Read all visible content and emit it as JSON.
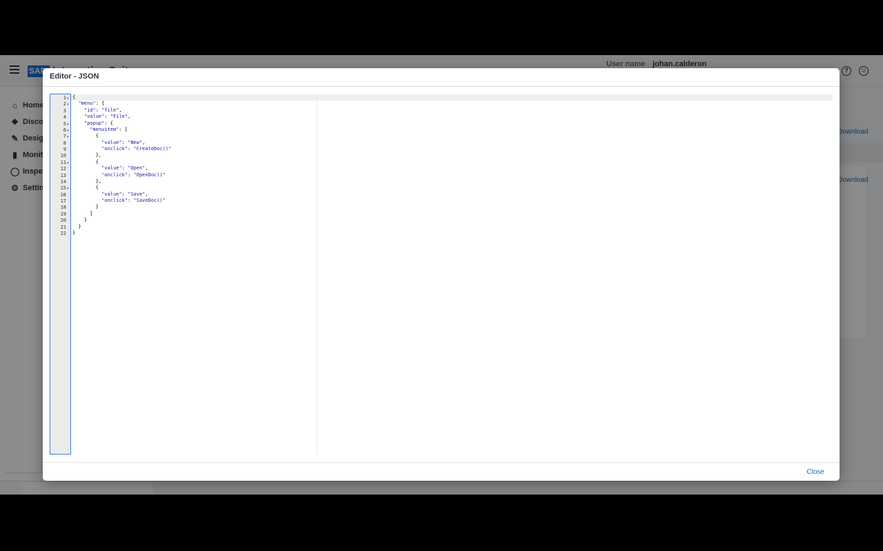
{
  "shell": {
    "logo_text": "SAP",
    "app_title": "Integration Suite",
    "user_label": "User name",
    "user_value": "johan.calderon"
  },
  "sidenav": {
    "items": [
      {
        "label": "Home",
        "icon": "home-icon"
      },
      {
        "label": "Discover",
        "icon": "compass-icon"
      },
      {
        "label": "Design",
        "icon": "pencil-icon"
      },
      {
        "label": "Monitor",
        "icon": "chart-bars-icon"
      },
      {
        "label": "Inspect",
        "icon": "gauge-icon"
      },
      {
        "label": "Settings",
        "icon": "gear-icon"
      }
    ]
  },
  "background": {
    "download_link": "Download",
    "download_link_2": "Download"
  },
  "dialog": {
    "title": "Editor - JSON",
    "close_label": "Close",
    "editor": {
      "line_numbers": [
        "1",
        "2",
        "3",
        "4",
        "5",
        "6",
        "7",
        "8",
        "9",
        "10",
        "11",
        "12",
        "13",
        "14",
        "15",
        "16",
        "17",
        "18",
        "19",
        "20",
        "21",
        "22"
      ],
      "fold_lines": [
        1,
        2,
        5,
        6,
        7,
        11,
        15
      ],
      "lines": [
        "{",
        "  \"menu\": {",
        "    \"id\": \"file\",",
        "    \"value\": \"File\",",
        "    \"popup\": {",
        "      \"menuitem\": [",
        "        {",
        "          \"value\": \"New\",",
        "          \"onclick\": \"CreateDoc()\"",
        "        },",
        "        {",
        "          \"value\": \"Open\",",
        "          \"onclick\": \"OpenDoc()\"",
        "        },",
        "        {",
        "          \"value\": \"Save\",",
        "          \"onclick\": \"SaveDoc()\"",
        "        }",
        "      ]",
        "    }",
        "  }",
        "}"
      ]
    }
  },
  "colors": {
    "accent": "#0a6ed1",
    "code_string": "#1a1aa6",
    "scrim": "rgba(0,0,0,0.45)"
  }
}
